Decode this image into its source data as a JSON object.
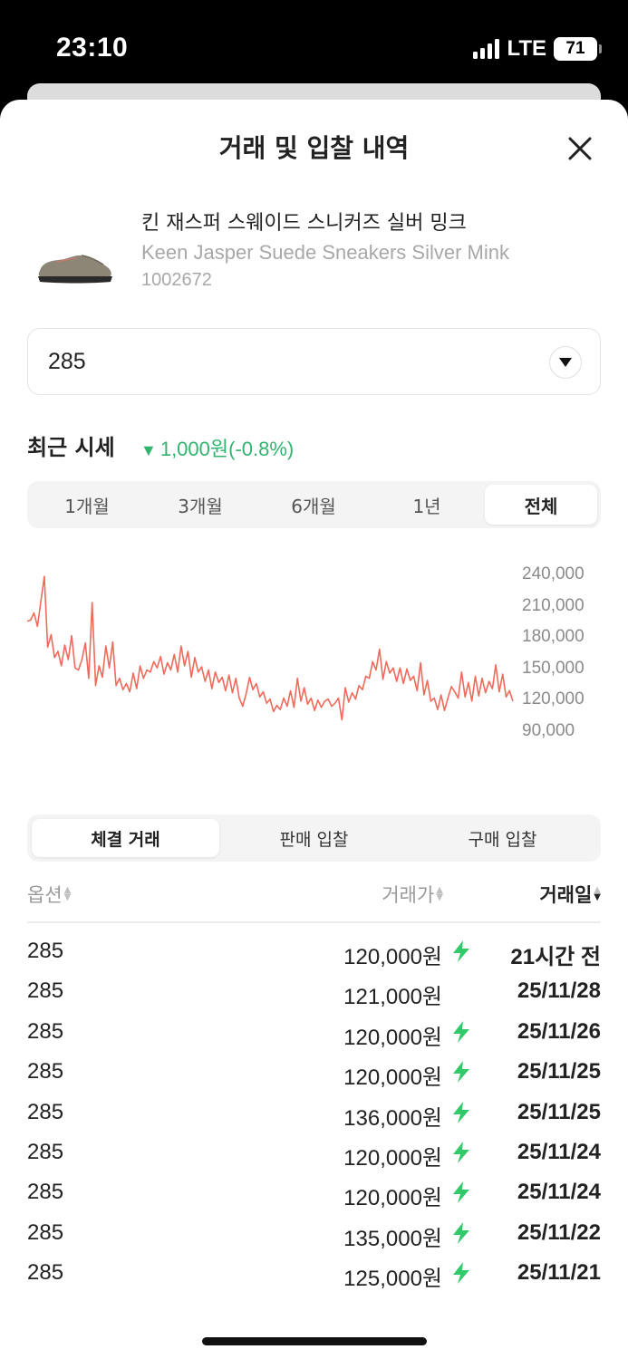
{
  "status_bar": {
    "time": "23:10",
    "network": "LTE",
    "battery": "71"
  },
  "sheet": {
    "title": "거래 및 입찰 내역"
  },
  "product": {
    "name_ko": "킨 재스퍼 스웨이드 스니커즈 실버 밍크",
    "name_en": "Keen Jasper Suede Sneakers Silver Mink",
    "code": "1002672"
  },
  "size_select": {
    "value": "285"
  },
  "recent": {
    "label": "최근 시세",
    "change_icon": "▼",
    "change_text": "1,000원(-0.8%)",
    "change_color": "#31b46e"
  },
  "period_tabs": [
    {
      "label": "1개월"
    },
    {
      "label": "3개월"
    },
    {
      "label": "6개월"
    },
    {
      "label": "1년"
    },
    {
      "label": "전체",
      "active": true
    }
  ],
  "chart_data": {
    "type": "line",
    "color": "#ef6a5b",
    "y_ticks": [
      "240,000",
      "210,000",
      "180,000",
      "150,000",
      "120,000",
      "90,000"
    ],
    "ylim": [
      90000,
      240000
    ],
    "values": [
      195000,
      196000,
      203000,
      190000,
      214000,
      238000,
      170000,
      182000,
      160000,
      166000,
      152000,
      172000,
      158000,
      181000,
      150000,
      148000,
      158000,
      174000,
      140000,
      213000,
      133000,
      152000,
      141000,
      171000,
      150000,
      175000,
      133000,
      140000,
      129000,
      135000,
      127000,
      145000,
      130000,
      152000,
      140000,
      148000,
      146000,
      156000,
      150000,
      161000,
      144000,
      155000,
      148000,
      163000,
      146000,
      171000,
      152000,
      166000,
      141000,
      160000,
      146000,
      151000,
      137000,
      148000,
      130000,
      146000,
      136000,
      141000,
      128000,
      143000,
      126000,
      140000,
      121000,
      113000,
      125000,
      141000,
      129000,
      135000,
      122000,
      127000,
      116000,
      120000,
      108000,
      114000,
      110000,
      121000,
      113000,
      128000,
      112000,
      140000,
      118000,
      131000,
      115000,
      121000,
      109000,
      119000,
      112000,
      118000,
      120000,
      113000,
      116000,
      121000,
      100000,
      131000,
      117000,
      126000,
      120000,
      133000,
      129000,
      142000,
      140000,
      156000,
      148000,
      168000,
      139000,
      156000,
      145000,
      150000,
      137000,
      150000,
      135000,
      149000,
      138000,
      142000,
      128000,
      155000,
      124000,
      138000,
      118000,
      121000,
      110000,
      124000,
      109000,
      121000,
      132000,
      127000,
      121000,
      146000,
      122000,
      136000,
      118000,
      142000,
      123000,
      140000,
      126000,
      137000,
      130000,
      153000,
      127000,
      144000,
      122000,
      128000,
      118000
    ]
  },
  "tx_tabs": [
    {
      "label": "체결 거래",
      "active": true
    },
    {
      "label": "판매 입찰"
    },
    {
      "label": "구매 입찰"
    }
  ],
  "table": {
    "headers": {
      "option": "옵션",
      "price": "거래가",
      "date": "거래일"
    },
    "rows": [
      {
        "option": "285",
        "price": "120,000원",
        "fast": true,
        "date": "21시간 전"
      },
      {
        "option": "285",
        "price": "121,000원",
        "fast": false,
        "date": "25/11/28"
      },
      {
        "option": "285",
        "price": "120,000원",
        "fast": true,
        "date": "25/11/26"
      },
      {
        "option": "285",
        "price": "120,000원",
        "fast": true,
        "date": "25/11/25"
      },
      {
        "option": "285",
        "price": "136,000원",
        "fast": true,
        "date": "25/11/25"
      },
      {
        "option": "285",
        "price": "120,000원",
        "fast": true,
        "date": "25/11/24"
      },
      {
        "option": "285",
        "price": "120,000원",
        "fast": true,
        "date": "25/11/24"
      },
      {
        "option": "285",
        "price": "135,000원",
        "fast": true,
        "date": "25/11/22"
      },
      {
        "option": "285",
        "price": "125,000원",
        "fast": true,
        "date": "25/11/21"
      }
    ]
  },
  "icons": {
    "close": "close-icon",
    "dropdown": "dropdown-triangle-icon",
    "fast_delivery": "lightning-bolt-icon",
    "bolt_color": "#31c96a"
  }
}
